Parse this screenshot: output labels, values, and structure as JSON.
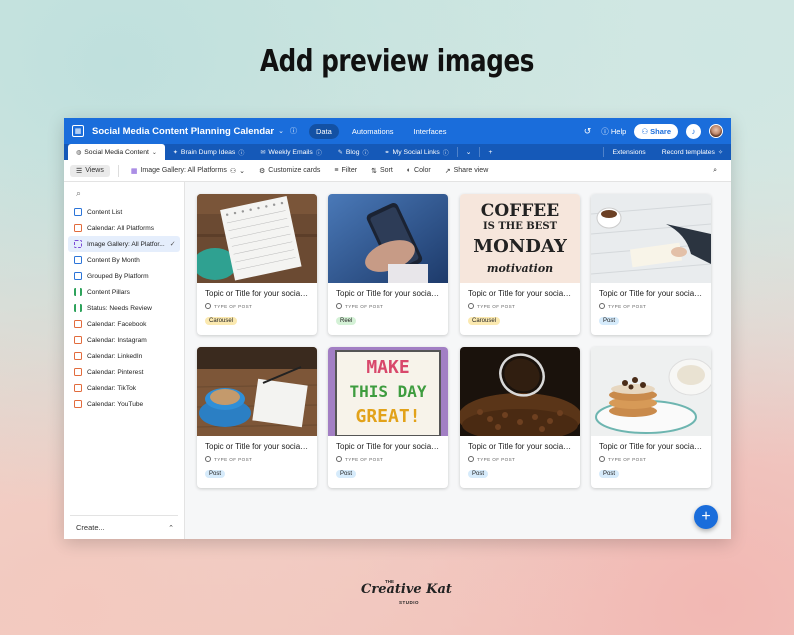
{
  "headline": "Add preview images",
  "app": {
    "base_title": "Social Media Content Planning Calendar",
    "nav_tabs": [
      "Data",
      "Automations",
      "Interfaces"
    ],
    "help_label": "Help",
    "share_label": "Share"
  },
  "tabs": {
    "items": [
      "Social Media Content",
      "Brain Dump Ideas",
      "Weekly Emails",
      "Blog",
      "My Social Links"
    ],
    "extensions": "Extensions",
    "record_templates": "Record templates"
  },
  "toolbar": {
    "views": "Views",
    "current_view": "Image Gallery: All Platforms",
    "customize": "Customize cards",
    "filter": "Filter",
    "sort": "Sort",
    "color": "Color",
    "share_view": "Share view"
  },
  "sidebar": {
    "items": [
      {
        "label": "Content List",
        "icon": "grid-icon"
      },
      {
        "label": "Calendar: All Platforms",
        "icon": "calendar-icon"
      },
      {
        "label": "Image Gallery: All Platfor...",
        "icon": "gallery-icon"
      },
      {
        "label": "Content By Month",
        "icon": "grid-icon"
      },
      {
        "label": "Grouped By Platform",
        "icon": "grid-icon"
      },
      {
        "label": "Content Pillars",
        "icon": "kanban-icon"
      },
      {
        "label": "Status: Needs Review",
        "icon": "kanban-icon"
      },
      {
        "label": "Calendar: Facebook",
        "icon": "calendar-icon"
      },
      {
        "label": "Calendar: Instagram",
        "icon": "calendar-icon"
      },
      {
        "label": "Calendar: LinkedIn",
        "icon": "calendar-icon"
      },
      {
        "label": "Calendar: Pinterest",
        "icon": "calendar-icon"
      },
      {
        "label": "Calendar: TikTok",
        "icon": "calendar-icon"
      },
      {
        "label": "Calendar: YouTube",
        "icon": "calendar-icon"
      }
    ],
    "create_label": "Create..."
  },
  "cards": [
    {
      "title": "Topic or Title for your social media post...",
      "field_label": "TYPE OF POST",
      "type": "Carousel",
      "pill_color": "#fbe9b0",
      "image": "notebook-photo"
    },
    {
      "title": "Topic or Title for your social media post...",
      "field_label": "TYPE OF POST",
      "type": "Reel",
      "pill_color": "#d4f1d6",
      "image": "phone-hand-photo"
    },
    {
      "title": "Topic or Title for your social media post...",
      "field_label": "TYPE OF POST",
      "type": "Carousel",
      "pill_color": "#fbe9b0",
      "image": "coffee-sign-photo",
      "image_text": [
        "COFFEE",
        "IS THE BEST",
        "MONDAY",
        "motivation"
      ]
    },
    {
      "title": "Topic or Title for your social media post...",
      "field_label": "TYPE OF POST",
      "type": "Post",
      "pill_color": "#d6ebfb",
      "image": "writing-photo"
    },
    {
      "title": "Topic or Title for your social media post...",
      "field_label": "TYPE OF POST",
      "type": "Post",
      "pill_color": "#d6ebfb",
      "image": "latte-notebook-photo"
    },
    {
      "title": "Topic or Title for your social media post...",
      "field_label": "TYPE OF POST",
      "type": "Post",
      "pill_color": "#d6ebfb",
      "image": "lightbox-photo",
      "image_text": [
        "MAKE",
        "THIS DAY",
        "GREAT!"
      ]
    },
    {
      "title": "Topic or Title for your social media post...",
      "field_label": "TYPE OF POST",
      "type": "Post",
      "pill_color": "#d6ebfb",
      "image": "coffee-beans-photo"
    },
    {
      "title": "Topic or Title for your social media post...",
      "field_label": "TYPE OF POST",
      "type": "Post",
      "pill_color": "#d6ebfb",
      "image": "pancakes-photo"
    }
  ],
  "brand": {
    "the": "THE",
    "name": "Creative Kat",
    "studio": "STUDIO"
  },
  "colors": {
    "primary": "#1a6ddb",
    "tabbar": "#1559b8",
    "active_view": "#e5eefc"
  }
}
